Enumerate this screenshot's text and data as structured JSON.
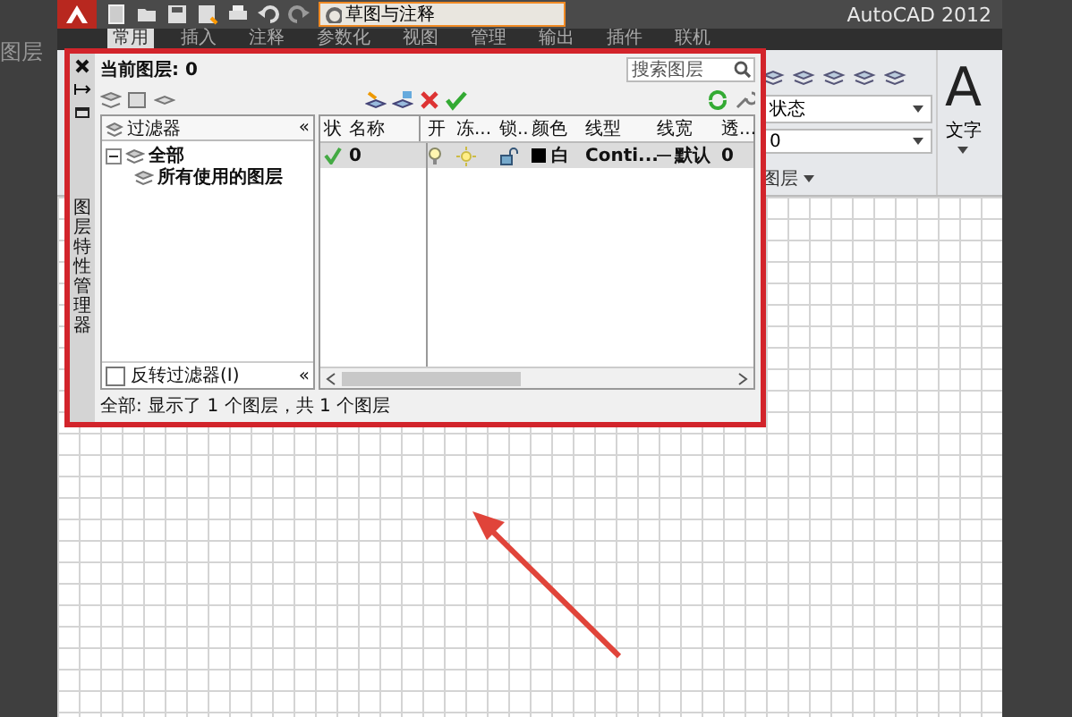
{
  "app": {
    "workspace": "草图与注释",
    "title": "AutoCAD 2012",
    "background_text": "图层"
  },
  "ribbon_tabs": [
    {
      "label": "常用",
      "selected": true
    },
    {
      "label": "插入",
      "selected": false
    },
    {
      "label": "注释",
      "selected": false
    },
    {
      "label": "参数化",
      "selected": false
    },
    {
      "label": "视图",
      "selected": false
    },
    {
      "label": "管理",
      "selected": false
    },
    {
      "label": "输出",
      "selected": false
    },
    {
      "label": "插件",
      "selected": false
    },
    {
      "label": "联机",
      "selected": false
    }
  ],
  "ribbon": {
    "layer_state": "状态",
    "current_layer": "0",
    "layer_panel_label": "图层",
    "text_big": "A",
    "text_panel_label": "文字"
  },
  "palette": {
    "vertical_title": "图层特性管理器",
    "current_layer": "当前图层: 0",
    "search": {
      "placeholder": "搜索图层"
    },
    "filters": {
      "header": "过滤器",
      "collapse": "«",
      "tree": [
        {
          "label": "全部",
          "expanded": true,
          "children": [
            {
              "label": "所有使用的图层"
            }
          ]
        }
      ],
      "invert": {
        "label": "反转过滤器(I)",
        "checked": false
      },
      "bottom_collapse": "«"
    },
    "columns": [
      "状",
      "名称",
      "开",
      "冻...",
      "锁..",
      "颜色",
      "线型",
      "线宽",
      "透..."
    ],
    "rows": [
      {
        "selected": true,
        "current": true,
        "name": "0",
        "on": true,
        "frozen": false,
        "locked": false,
        "color": "#000000",
        "color_name": "白",
        "linetype": "Conti...",
        "lineweight": "默认",
        "transparency": "0"
      }
    ],
    "status": "全部: 显示了 1 个图层，共 1 个图层"
  }
}
